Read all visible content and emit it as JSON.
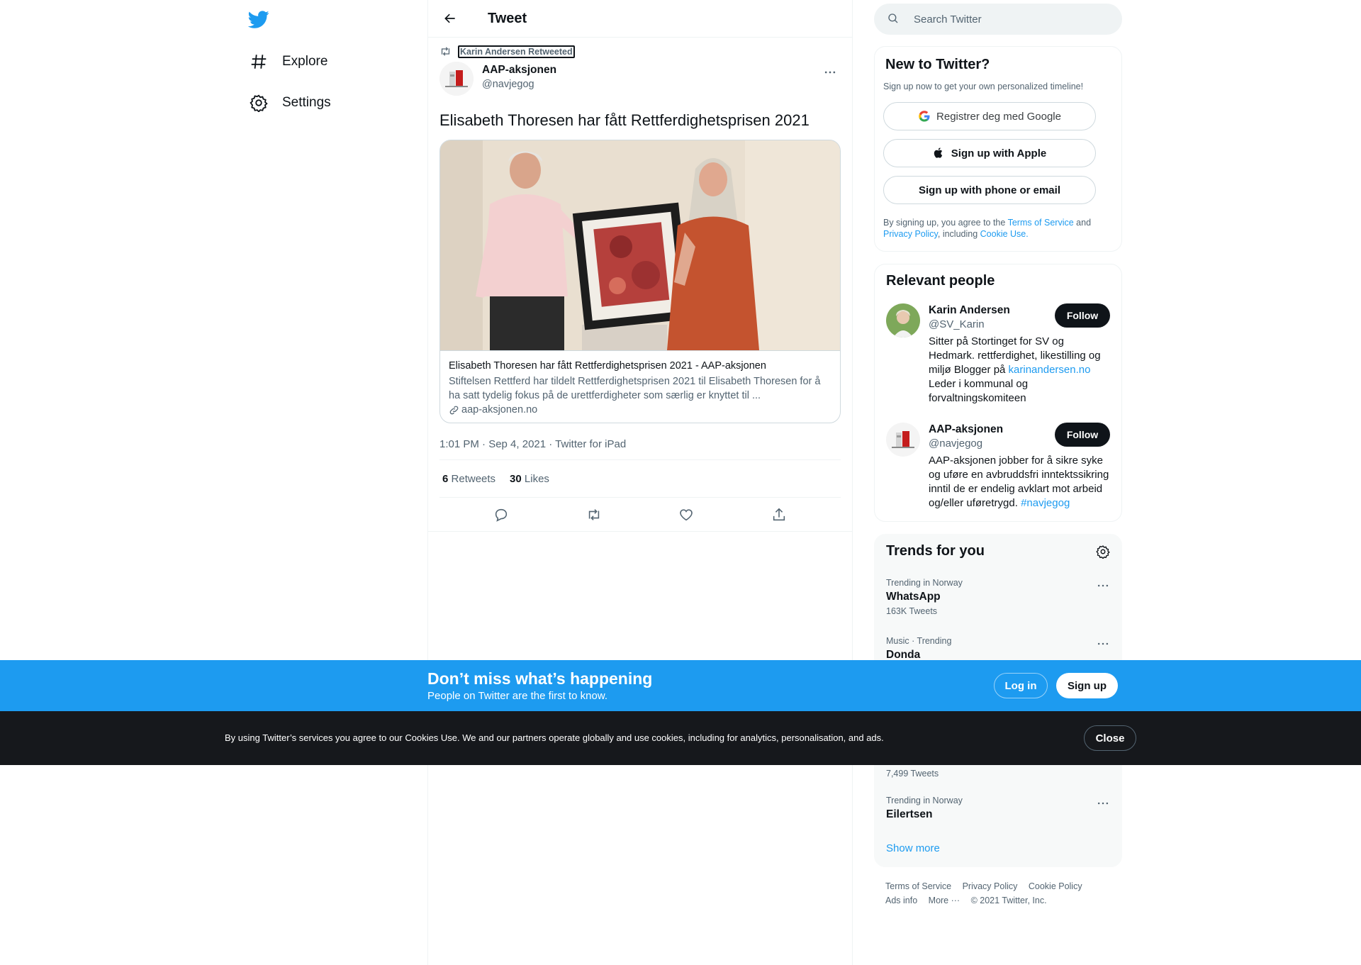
{
  "nav": {
    "logo": "twitter-bird-icon",
    "items": [
      {
        "label": "Explore",
        "icon": "hashtag-icon"
      },
      {
        "label": "Settings",
        "icon": "gear-icon"
      }
    ]
  },
  "header": {
    "title": "Tweet",
    "back_icon": "arrow-left-icon"
  },
  "tweet": {
    "retweeted_by": "Karin Andersen Retweeted",
    "author": {
      "name": "AAP-aksjonen",
      "handle": "@navjegog"
    },
    "text": "Elisabeth Thoresen har fått Rettferdighetsprisen 2021",
    "card": {
      "title": "Elisabeth Thoresen har fått Rettferdighetsprisen 2021 - AAP-aksjonen",
      "description": "Stiftelsen Rettferd har tildelt Rettferdighetsprisen 2021 til Elisabeth Thoresen for å ha satt tydelig fokus på de urettferdigheter som særlig er knyttet til ...",
      "domain": "aap-aksjonen.no"
    },
    "meta": "1:01 PM · Sep 4, 2021 · Twitter for iPad",
    "stats": {
      "retweets": "6",
      "retweets_label": "Retweets",
      "likes": "30",
      "likes_label": "Likes"
    }
  },
  "search": {
    "placeholder": "Search Twitter"
  },
  "signup": {
    "title": "New to Twitter?",
    "subtitle": "Sign up now to get your own personalized timeline!",
    "google_label": "Registrer deg med Google",
    "apple_label": "Sign up with Apple",
    "phone_label": "Sign up with phone or email",
    "legal_prefix": "By signing up, you agree to the ",
    "terms": "Terms of Service",
    "and": " and ",
    "privacy": "Privacy Policy",
    "including": ", including ",
    "cookie": "Cookie Use."
  },
  "people": {
    "title": "Relevant people",
    "list": [
      {
        "name": "Karin Andersen",
        "handle": "@SV_Karin",
        "bio_before": "Sitter på Stortinget for SV og Hedmark. rettferdighet, likestilling og miljø Blogger på ",
        "bio_link": "karinandersen.no",
        "bio_after": " Leder i kommunal og forvaltningskomiteen",
        "follow": "Follow"
      },
      {
        "name": "AAP-aksjonen",
        "handle": "@navjegog",
        "bio_before": "AAP-aksjonen jobber for å sikre syke og uføre en avbruddsfri inntektssikring inntil de er endelig avklart mot arbeid og/eller uføretrygd. ",
        "bio_link": "#navjegog",
        "bio_after": "",
        "follow": "Follow"
      }
    ]
  },
  "trends": {
    "title": "Trends for you",
    "items": [
      {
        "context": "Trending in Norway",
        "name": "WhatsApp",
        "count": "163K Tweets"
      },
      {
        "context": "Music · Trending",
        "name": "Donda",
        "count": ""
      },
      {
        "context": "",
        "name": "",
        "count": "7,499 Tweets"
      },
      {
        "context": "Trending in Norway",
        "name": "Eilertsen",
        "count": ""
      }
    ],
    "show_more": "Show more"
  },
  "footer": {
    "links": [
      "Terms of Service",
      "Privacy Policy",
      "Cookie Policy",
      "Ads info",
      "More ···",
      "© 2021 Twitter, Inc."
    ]
  },
  "banner": {
    "title": "Don’t miss what’s happening",
    "subtitle": "People on Twitter are the first to know.",
    "login": "Log in",
    "signup": "Sign up"
  },
  "cookie": {
    "text": "By using Twitter’s services you agree to our Cookies Use. We and our partners operate globally and use cookies, including for analytics, personalisation, and ads.",
    "close": "Close"
  },
  "colors": {
    "brand": "#1d9bf0",
    "text": "#0f1419",
    "muted": "#536471",
    "cookie_bar": "#16181c"
  }
}
